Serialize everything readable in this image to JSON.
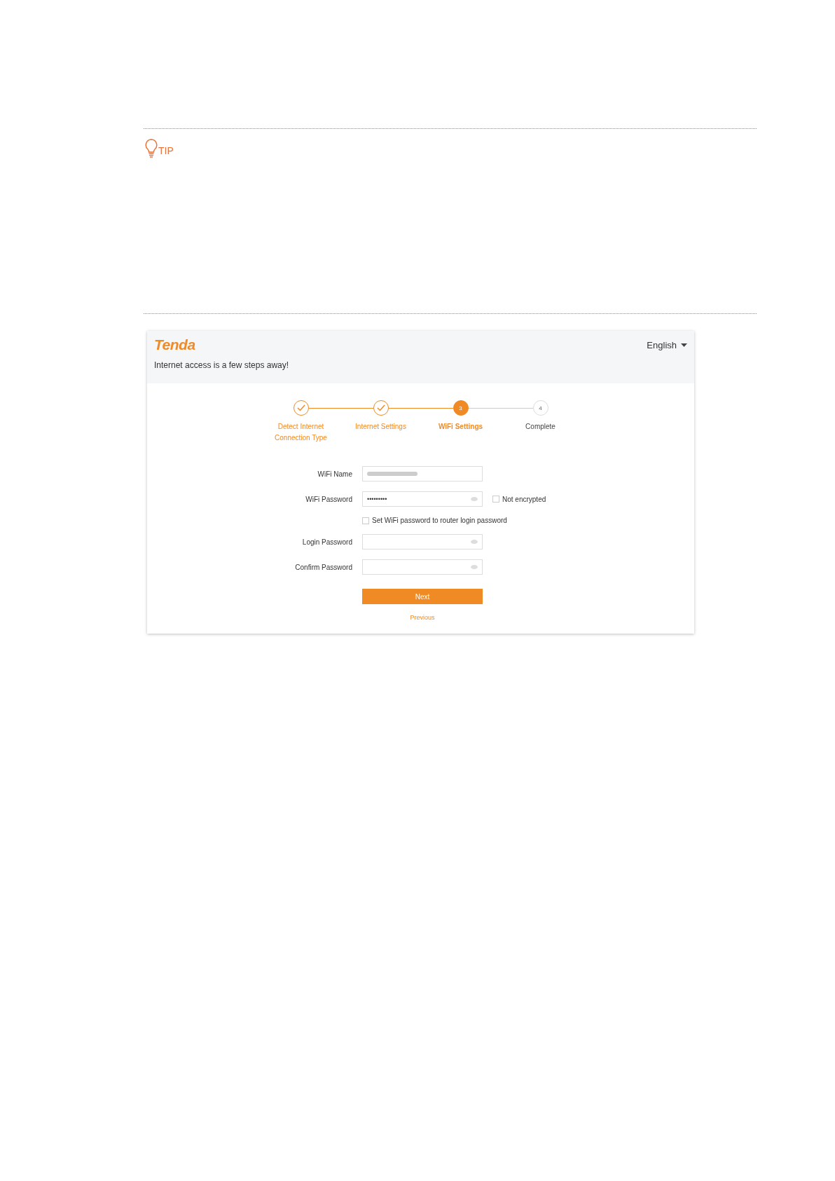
{
  "tip": {
    "label": "TIP"
  },
  "router_page": {
    "logo": "Tenda",
    "language": "English",
    "subtitle": "Internet access is a few steps away!",
    "steps": [
      {
        "label_lines": [
          "Detect Internet",
          "Connection Type"
        ],
        "kind": "done"
      },
      {
        "label_lines": [
          "Internet Settings"
        ],
        "kind": "done"
      },
      {
        "number": "3",
        "label_lines": [
          "WiFi Settings"
        ],
        "kind": "current"
      },
      {
        "number": "4",
        "label_lines": [
          "Complete"
        ],
        "kind": "pending"
      }
    ],
    "fields": [
      {
        "label": "WiFi Name",
        "kind": "blurred"
      },
      {
        "label": "WiFi Password",
        "kind": "password",
        "value": "•••••••••",
        "option": {
          "label": "Not encrypted",
          "checked": false
        }
      },
      {
        "label": "Login Password",
        "kind": "password"
      },
      {
        "label": "Confirm Password",
        "kind": "password"
      }
    ],
    "sync_option": {
      "label": "Set WiFi password to router login password",
      "checked": false
    },
    "next_button": "Next",
    "previous_link": "Previous"
  }
}
